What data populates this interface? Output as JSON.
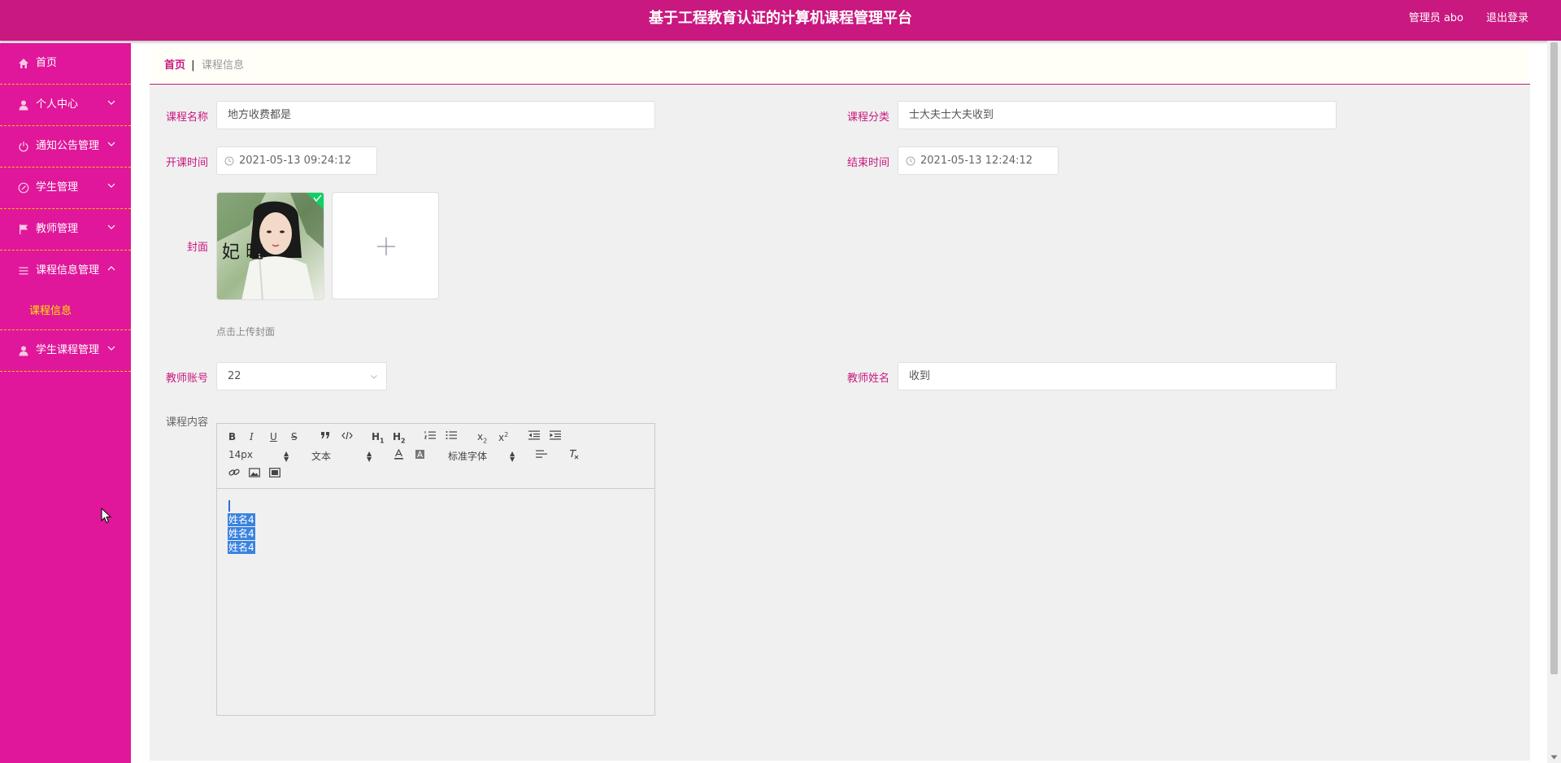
{
  "header": {
    "title": "基于工程教育认证的计算机课程管理平台",
    "user": "管理员 abo",
    "logout": "退出登录"
  },
  "sidebar": {
    "items": [
      {
        "label": "首页",
        "icon": "home-icon"
      },
      {
        "label": "个人中心",
        "icon": "user-icon"
      },
      {
        "label": "通知公告管理",
        "icon": "power-icon"
      },
      {
        "label": "学生管理",
        "icon": "compass-icon"
      },
      {
        "label": "教师管理",
        "icon": "flag-icon"
      },
      {
        "label": "课程信息管理",
        "icon": "menu-icon",
        "sub": "课程信息"
      },
      {
        "label": "学生课程管理",
        "icon": "user-icon"
      }
    ]
  },
  "breadcrumb": {
    "home": "首页",
    "separator": "|",
    "current": "课程信息"
  },
  "form": {
    "course_name_label": "课程名称",
    "course_name": "地方收费都是",
    "category_label": "课程分类",
    "category": "士大夫士大夫收到",
    "start_label": "开课时间",
    "start_time": "2021-05-13 09:24:12",
    "end_label": "结束时间",
    "end_time": "2021-05-13 12:24:12",
    "cover_label": "封面",
    "cover_image_text": "妃 暄",
    "upload_hint": "点击上传封面",
    "teacher_account_label": "教师账号",
    "teacher_account": "22",
    "teacher_name_label": "教师姓名",
    "teacher_name": "收到",
    "content_label": "课程内容"
  },
  "editor": {
    "font_size": "14px",
    "text_type": "文本",
    "font_family": "标准字体",
    "h1": "H",
    "h2": "H",
    "sub_x": "x",
    "sup_x": "x",
    "content_lines": [
      "姓名4",
      "姓名4",
      "姓名4"
    ]
  },
  "colors": {
    "header": "#c9187f",
    "sidebar": "#e0179a",
    "accent": "#c9187f",
    "submenu_active": "#ffe100"
  }
}
